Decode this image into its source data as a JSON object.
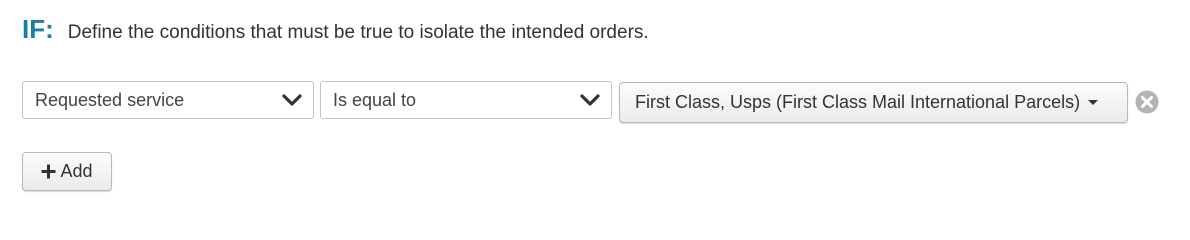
{
  "header": {
    "if_label": "IF:",
    "description": "Define the conditions that must be true to isolate the intended orders."
  },
  "condition": {
    "field": {
      "selected": "Requested service",
      "icon": "chevron-down-icon"
    },
    "operator": {
      "selected": "Is equal to",
      "icon": "chevron-down-icon"
    },
    "value": {
      "selected": "First Class, Usps (First Class Mail International Parcels)",
      "icon": "caret-down-icon"
    },
    "remove_icon": "close-circle-icon"
  },
  "add_button": {
    "label": "Add",
    "icon": "plus-icon"
  },
  "colors": {
    "accent": "#1a7fa6",
    "text": "#333333",
    "border": "#c5c5c5",
    "remove_icon": "#b3b3b3"
  }
}
